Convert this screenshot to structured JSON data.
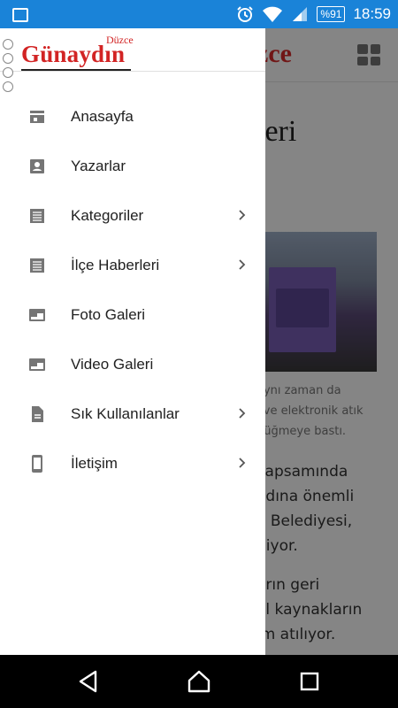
{
  "status_bar": {
    "battery": "%91",
    "time": "18:59",
    "icons": [
      "image-icon",
      "alarm-icon",
      "wifi-icon",
      "signal-icon",
      "battery-icon"
    ]
  },
  "drawer": {
    "logo": {
      "main": "Günaydın",
      "superscript": "Düzce"
    },
    "menu": [
      {
        "label": "Anasayfa",
        "icon": "store-icon",
        "has_submenu": false
      },
      {
        "label": "Yazarlar",
        "icon": "contact-icon",
        "has_submenu": false
      },
      {
        "label": "Kategoriler",
        "icon": "list-icon",
        "has_submenu": true
      },
      {
        "label": "İlçe Haberleri",
        "icon": "list-icon",
        "has_submenu": true
      },
      {
        "label": "Foto Galeri",
        "icon": "window-icon",
        "has_submenu": false
      },
      {
        "label": "Video Galeri",
        "icon": "window-icon",
        "has_submenu": false
      },
      {
        "label": "Sık Kullanılanlar",
        "icon": "document-icon",
        "has_submenu": true
      },
      {
        "label": "İletişim",
        "icon": "phone-icon",
        "has_submenu": true
      }
    ]
  },
  "background_page": {
    "header_logo": "zce",
    "title": "leri",
    "caption": [
      "aynı zaman da",
      "i ve elektronik atık",
      "düğmeye bastı."
    ],
    "body": [
      "kapsamında",
      "adına önemli",
      "a Belediyesi,",
      "diyor.",
      "",
      "arın geri",
      "al kaynakların",
      "ım atılıyor."
    ]
  },
  "colors": {
    "status_bar": "#1a83d8",
    "logo_red": "#d22424",
    "icon_gray": "#757575"
  }
}
